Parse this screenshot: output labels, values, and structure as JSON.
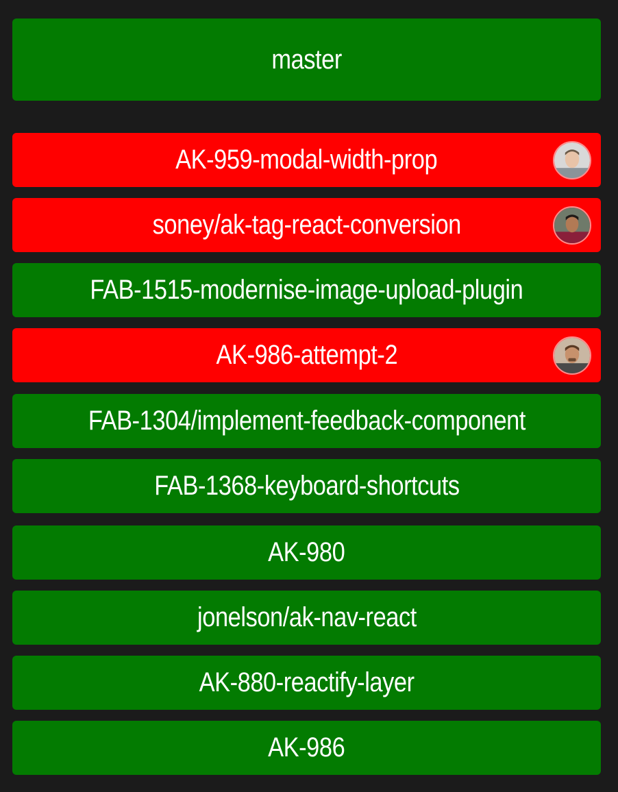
{
  "colors": {
    "background": "#1b1b1b",
    "passing": "#037b01",
    "failing": "#ff0000",
    "text": "#ffffff"
  },
  "master": {
    "label": "master",
    "status": "passing"
  },
  "branches": [
    {
      "label": "AK-959-modal-width-prop",
      "status": "failing",
      "avatar": "user-avatar-1"
    },
    {
      "label": "soney/ak-tag-react-conversion",
      "status": "failing",
      "avatar": "user-avatar-2"
    },
    {
      "label": "FAB-1515-modernise-image-upload-plugin",
      "status": "passing"
    },
    {
      "label": "AK-986-attempt-2",
      "status": "failing",
      "avatar": "user-avatar-3"
    },
    {
      "label": "FAB-1304/implement-feedback-component",
      "status": "passing"
    },
    {
      "label": "FAB-1368-keyboard-shortcuts",
      "status": "passing"
    },
    {
      "label": "AK-980",
      "status": "passing"
    },
    {
      "label": "jonelson/ak-nav-react",
      "status": "passing"
    },
    {
      "label": "AK-880-reactify-layer",
      "status": "passing"
    },
    {
      "label": "AK-986",
      "status": "passing"
    }
  ]
}
